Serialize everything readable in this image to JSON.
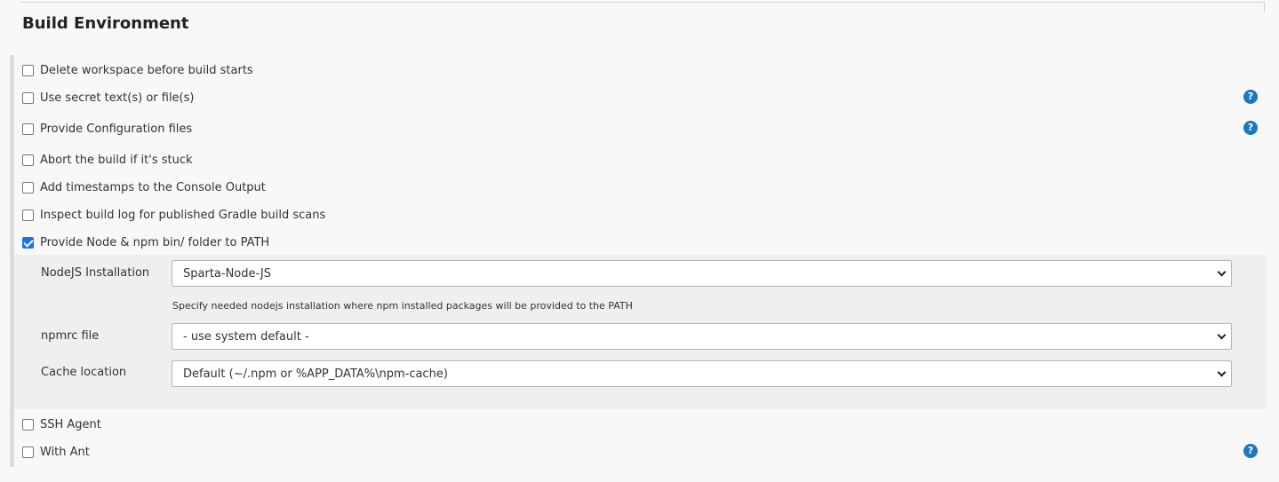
{
  "section": {
    "title": "Build Environment"
  },
  "options": [
    {
      "label": "Delete workspace before build starts",
      "checked": false,
      "help": false
    },
    {
      "label": "Use secret text(s) or file(s)",
      "checked": false,
      "help": true
    },
    {
      "label": "Provide Configuration files",
      "checked": false,
      "help": true
    },
    {
      "label": "Abort the build if it's stuck",
      "checked": false,
      "help": false
    },
    {
      "label": "Add timestamps to the Console Output",
      "checked": false,
      "help": false
    },
    {
      "label": "Inspect build log for published Gradle build scans",
      "checked": false,
      "help": false
    },
    {
      "label": "Provide Node & npm bin/ folder to PATH",
      "checked": true,
      "help": false
    },
    {
      "label": "SSH Agent",
      "checked": false,
      "help": false
    },
    {
      "label": "With Ant",
      "checked": false,
      "help": true
    }
  ],
  "help_icon": {
    "glyph": "?",
    "name": "help-icon"
  },
  "node": {
    "installation_label": "NodeJS Installation",
    "installation_value": "Sparta-Node-JS",
    "installation_desc": "Specify needed nodejs installation where npm installed packages will be provided to the PATH",
    "npmrc_label": "npmrc file",
    "npmrc_value": "- use system default -",
    "cache_label": "Cache location",
    "cache_value": "Default (~/.npm or %APP_DATA%\\npm-cache)"
  },
  "colors": {
    "accent": "#1a73e8",
    "help": "#1a78c2"
  }
}
